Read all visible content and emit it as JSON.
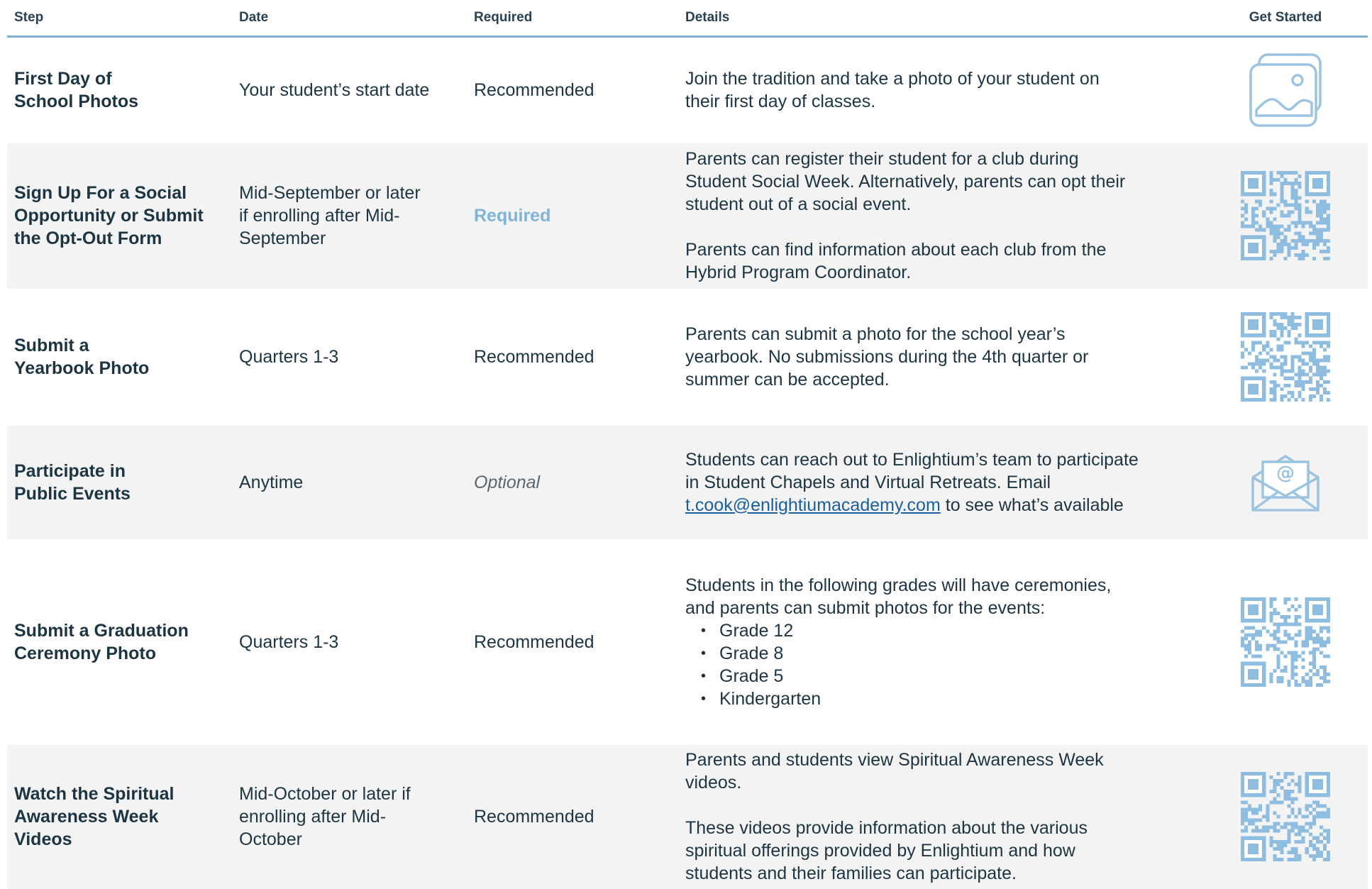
{
  "header": {
    "step": "Step",
    "date": "Date",
    "required": "Required",
    "details": "Details",
    "get_started": "Get Started"
  },
  "rows": [
    {
      "step": "First Day of School Photos",
      "date": "Your student’s start date",
      "required": "Recommended",
      "details": [
        "Join the tradition and take a photo of your student on their first day of classes."
      ],
      "icon": "photo-icon"
    },
    {
      "step": "Sign Up For a Social Opportunity or Submit the Opt-Out Form",
      "date": "Mid-September or later if enrolling after Mid-September",
      "required": "Required",
      "details": [
        "Parents can register their student for a club during Student Social Week. Alternatively, parents can opt their student out of a social event.",
        "Parents can find information about each club from the Hybrid Program Coordinator."
      ],
      "icon": "qr-code-icon"
    },
    {
      "step": "Submit a Yearbook Photo",
      "date": "Quarters 1-3",
      "required": "Recommended",
      "details": [
        "Parents can submit a photo for the school year’s yearbook. No submissions during the 4th quarter or summer can be accepted."
      ],
      "icon": "qr-code-icon"
    },
    {
      "step": "Participate in Public Events",
      "date": "Anytime",
      "required": "Optional",
      "details_before_link": "Students can reach out to Enlightium’s team to participate in Student Chapels and Virtual Retreats. Email",
      "email": "t.cook@enlightiumacademy.com",
      "details_after_link": "to see what’s available",
      "icon": "email-icon"
    },
    {
      "step": "Submit a Graduation Ceremony Photo",
      "date": "Quarters 1-3",
      "required": "Recommended",
      "details": [
        "Students in the following grades will have ceremonies, and parents can submit photos for the events:"
      ],
      "grades": [
        "Grade 12",
        "Grade 8",
        "Grade 5",
        "Kindergarten"
      ],
      "icon": "qr-code-icon"
    },
    {
      "step": "Watch the Spiritual Awareness Week Videos",
      "date": "Mid-October or later if enrolling after Mid-October",
      "required": "Recommended",
      "details": [
        "Parents and students view Spiritual Awareness Week videos.",
        "These videos provide information about the various spiritual offerings provided by Enlightium and how students and their families can participate."
      ],
      "icon": "qr-code-icon"
    }
  ],
  "colors": {
    "accent": "#7fb3d8",
    "header_rule": "#7fb1cf",
    "row_alt": "#f3f3f3",
    "link": "#1a5fa0"
  }
}
